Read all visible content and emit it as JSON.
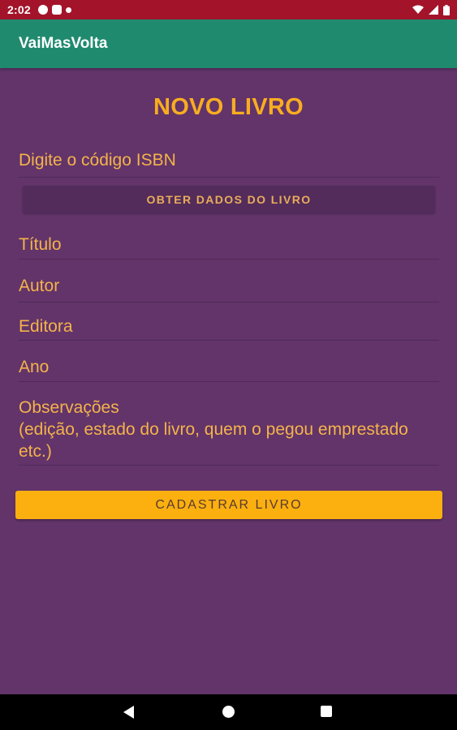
{
  "status_bar": {
    "time": "2:02",
    "notifications": [
      "circle-notification-icon",
      "square-notification-icon",
      "dot-notification-icon"
    ],
    "icons": [
      "wifi-icon",
      "signal-icon",
      "battery-icon"
    ]
  },
  "app_bar": {
    "title": "VaiMasVolta"
  },
  "form": {
    "title": "NOVO LIVRO",
    "isbn_placeholder": "Digite o código ISBN",
    "fetch_button": "OBTER DADOS DO LIVRO",
    "titulo_placeholder": "Título",
    "autor_placeholder": "Autor",
    "editora_placeholder": "Editora",
    "ano_placeholder": "Ano",
    "observacoes_line1": "Observações",
    "observacoes_line2": "(edição, estado do livro, quem o pegou emprestado",
    "observacoes_line3": "etc.)",
    "submit_button": "CADASTRAR LIVRO"
  },
  "colors": {
    "status_bar": "#a3142a",
    "app_bar": "#208a6f",
    "background": "#62346a",
    "accent": "#f8ad20",
    "submit_button": "#fbb010",
    "fetch_button": "#532c5b"
  },
  "nav_bar": {
    "buttons": [
      "back-icon",
      "home-icon",
      "recents-icon"
    ]
  }
}
